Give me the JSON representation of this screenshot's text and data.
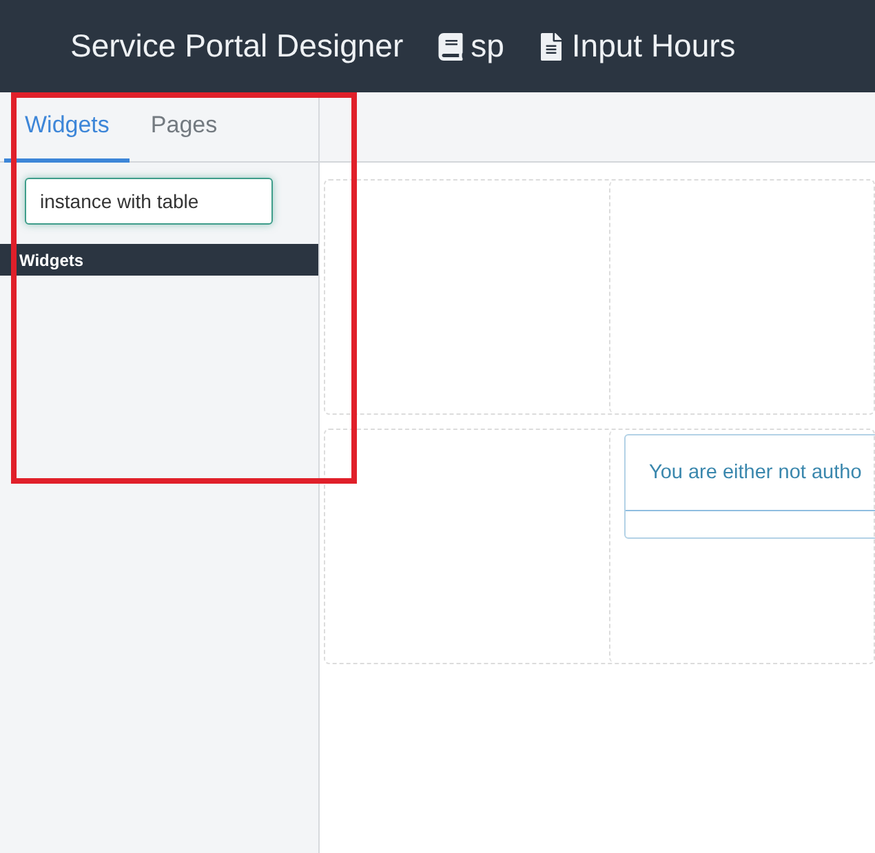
{
  "header": {
    "title": "Service Portal Designer",
    "portal": "sp",
    "page": "Input Hours"
  },
  "sidebar": {
    "tabs": [
      {
        "label": "Widgets",
        "selected": true
      },
      {
        "label": "Pages",
        "selected": false
      }
    ],
    "search": {
      "value": "instance with table"
    },
    "section_title": "Widgets"
  },
  "canvas": {
    "message": "You are either not autho"
  }
}
